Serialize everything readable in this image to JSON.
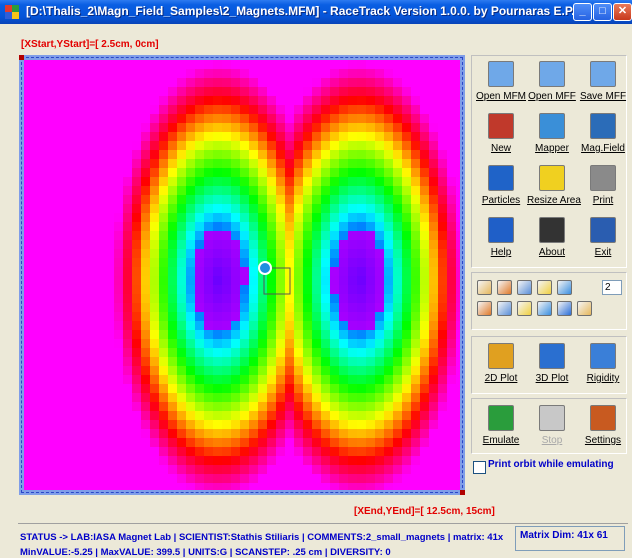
{
  "window": {
    "title": "[D:\\Thalis_2\\Magn_Field_Samples\\2_Magnets.MFM] - RaceTrack Version 1.0.0. by Pournaras E.P.",
    "minimize": "_",
    "maximize": "□",
    "close": "✕"
  },
  "plot": {
    "start_label": "[XStart,YStart]=[ 2.5cm, 0cm]",
    "end_label": "[XEnd,YEnd]=[ 12.5cm, 15cm]",
    "particle_color": "#1e8fe0"
  },
  "toolbar": {
    "file_buttons": [
      {
        "label": "Open MFM",
        "icon": "folder-open-icon"
      },
      {
        "label": "Open MFF",
        "icon": "folder-open-icon"
      },
      {
        "label": "Save MFF",
        "icon": "folder-save-icon"
      }
    ],
    "tool_buttons": [
      {
        "label": "New",
        "icon": "target-icon"
      },
      {
        "label": "Mapper",
        "icon": "map-icon"
      },
      {
        "label": "Mag.Field",
        "icon": "magnet-field-icon"
      }
    ],
    "action_buttons": [
      {
        "label": "Particles",
        "icon": "particles-icon"
      },
      {
        "label": "Resize Area",
        "icon": "resize-area-icon"
      },
      {
        "label": "Print",
        "icon": "printer-icon"
      }
    ],
    "help_buttons": [
      {
        "label": "Help",
        "icon": "help-icon"
      },
      {
        "label": "About",
        "icon": "about-icon"
      },
      {
        "label": "Exit",
        "icon": "exit-icon"
      }
    ],
    "spin_value": "2",
    "plot_buttons": [
      {
        "label": "2D Plot",
        "icon": "plot-2d-icon"
      },
      {
        "label": "3D Plot",
        "icon": "plot-3d-icon"
      },
      {
        "label": "Rigidity",
        "icon": "rigidity-icon"
      }
    ],
    "emulate_buttons": [
      {
        "label": "Emulate",
        "icon": "emulate-icon",
        "enabled": true
      },
      {
        "label": "Stop",
        "icon": "stop-icon",
        "enabled": false
      },
      {
        "label": "Settings",
        "icon": "settings-tools-icon",
        "enabled": true
      }
    ],
    "print_orbit_label": "Print orbit while emulating",
    "print_orbit_checked": false
  },
  "status": {
    "line1": "STATUS -> LAB:IASA Magnet Lab | SCIENTIST:Stathis Stiliaris | COMMENTS:2_small_magnets | matrix: 41x",
    "line2": "MinVALUE:-5.25 | MaxVALUE: 399.5 | UNITS:G | SCANSTEP: .25 cm | DIVERSITY: 0",
    "matrix_dim": "Matrix Dim: 41x 61"
  }
}
